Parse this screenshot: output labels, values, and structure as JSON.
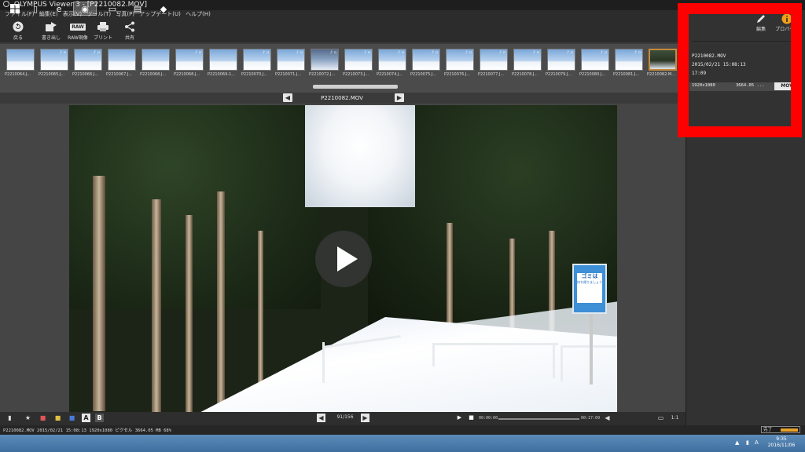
{
  "window": {
    "title": "OLYMPUS Viewer 3 - [P2210082.MOV]"
  },
  "menu": [
    "ファイル(F)",
    "編集(E)",
    "表示(V)",
    "ツール(T)",
    "写真(P)",
    "アップデート(U)",
    "ヘルプ(H)"
  ],
  "toolbar": {
    "back": "戻る",
    "export": "書き出し",
    "raw_dev": "RAW現像",
    "print": "プリント",
    "share": "共有",
    "raw_badge": "RAW"
  },
  "thumbnails": [
    {
      "caption": "P2210064.J...",
      "tag": ""
    },
    {
      "caption": "P2210065.J...",
      "tag": "♪ ▫"
    },
    {
      "caption": "P2210066.J...",
      "tag": "♪ ▫"
    },
    {
      "caption": "P2210067.J...",
      "tag": ""
    },
    {
      "caption": "P2210068.J...",
      "tag": ""
    },
    {
      "caption": "P2210068.J...",
      "tag": "♪ ▫"
    },
    {
      "caption": "P2210069-1...",
      "tag": ""
    },
    {
      "caption": "P2210070.J...",
      "tag": "♪ ▫"
    },
    {
      "caption": "P2210071.J...",
      "tag": "♪ ▫"
    },
    {
      "caption": "P2210072.J...",
      "tag": "♪ ▫"
    },
    {
      "caption": "P2210073.J...",
      "tag": "♪ ▫"
    },
    {
      "caption": "P2210074.J...",
      "tag": "♪ ▫"
    },
    {
      "caption": "P2210075.J...",
      "tag": "♪ ▫"
    },
    {
      "caption": "P2210076.J...",
      "tag": "♪ ▫"
    },
    {
      "caption": "P2210077.J...",
      "tag": "♪ ▫"
    },
    {
      "caption": "P2210078.J...",
      "tag": "♪ ▫"
    },
    {
      "caption": "P2210079.J...",
      "tag": "♪ ▫"
    },
    {
      "caption": "P2210080.J...",
      "tag": "♪ ▫"
    },
    {
      "caption": "P2210081.J...",
      "tag": "♪ ▫"
    },
    {
      "caption": "P2210082.M...",
      "tag": "",
      "selected": true
    }
  ],
  "nav": {
    "filename": "P2210082.MOV"
  },
  "preview": {
    "sign_text_1": "ゴミは",
    "sign_text_2": "持ち帰りましょう"
  },
  "right_panel": {
    "edit": "編集",
    "properties": "プロパティ",
    "filename": "P2210082.MOV",
    "datetime": "2015/02/21 15:08:13",
    "duration": "17:09",
    "resolution": "1920x1080",
    "size": "3664.05 ...",
    "format": "MOV"
  },
  "controls": {
    "counter": "91/156",
    "time_start": "00:00:00",
    "time_end": "00:17:09",
    "ratio": "1:1"
  },
  "status": {
    "text": "P2210082.MOV 2015/02/21 15:08:13 1920x1080 ピクセル 3664.05 MB 68%",
    "done_label": "完了",
    "done_progress": 1.0
  },
  "taskbar": {
    "time": "9:35",
    "date": "2016/11/06",
    "ime": "A"
  },
  "colors": {
    "highlight": "#ff0000",
    "selected_thumb_border": "#c58b3c",
    "progress": "#e8a12a",
    "taskbar": "#4a7db0"
  }
}
